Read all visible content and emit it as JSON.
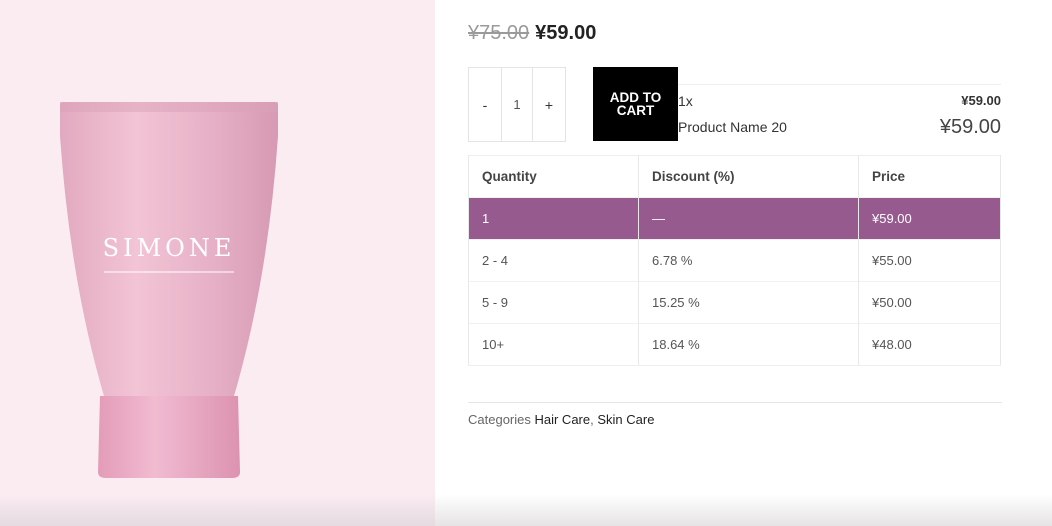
{
  "product": {
    "name": "Product Name 20",
    "brand_on_image": "SIMONE",
    "price_old": "¥75.00",
    "price_new": "¥59.00"
  },
  "cart": {
    "minus_label": "-",
    "quantity": "1",
    "plus_label": "+",
    "add_to_cart_label": "ADD TO CART"
  },
  "summary": {
    "qty_label": "1x",
    "unit_price": "¥59.00",
    "product_name": "Product Name 20",
    "total": "¥59.00"
  },
  "tier_table": {
    "headers": [
      "Quantity",
      "Discount (%)",
      "Price"
    ],
    "rows": [
      {
        "quantity": "1",
        "discount": "—",
        "price": "¥59.00",
        "active": true
      },
      {
        "quantity": "2 - 4",
        "discount": "6.78 %",
        "price": "¥55.00",
        "active": false
      },
      {
        "quantity": "5 - 9",
        "discount": "15.25 %",
        "price": "¥50.00",
        "active": false
      },
      {
        "quantity": "10+",
        "discount": "18.64 %",
        "price": "¥48.00",
        "active": false
      }
    ],
    "active_color": "#965a8f"
  },
  "categories": {
    "label": "Categories",
    "links": [
      "Hair Care",
      "Skin Care"
    ],
    "separator": ", "
  },
  "colors": {
    "image_background": "#fbecf2",
    "tube": "#e3aec4",
    "button": "#000000"
  }
}
